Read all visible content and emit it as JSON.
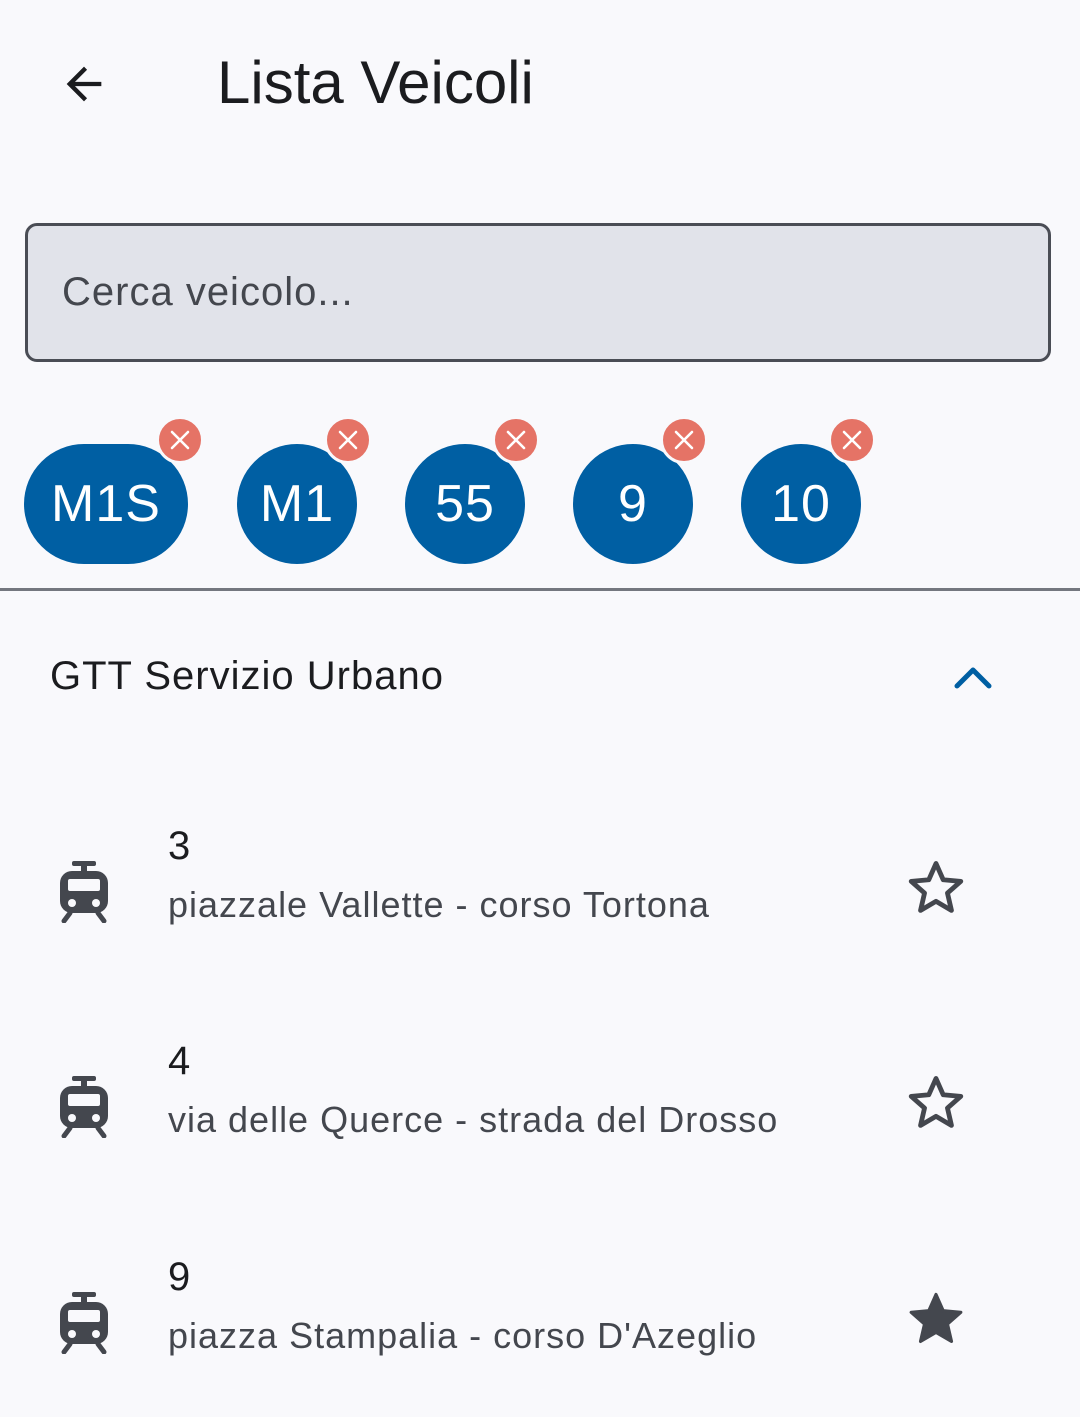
{
  "app_bar": {
    "back_icon": "arrow-back-icon",
    "title": "Lista Veicoli"
  },
  "search": {
    "placeholder": "Cerca veicolo...",
    "value": ""
  },
  "filter_chips": [
    {
      "label": "M1S",
      "remove_icon": "close-icon"
    },
    {
      "label": "M1",
      "remove_icon": "close-icon"
    },
    {
      "label": "55",
      "remove_icon": "close-icon"
    },
    {
      "label": "9",
      "remove_icon": "close-icon"
    },
    {
      "label": "10",
      "remove_icon": "close-icon"
    }
  ],
  "section": {
    "title": "GTT Servizio Urbano",
    "expanded": true,
    "toggle_icon": "chevron-up-icon"
  },
  "vehicles": [
    {
      "icon": "tram-icon",
      "line": "3",
      "route": "piazzale Vallette - corso Tortona",
      "favorite": false
    },
    {
      "icon": "tram-icon",
      "line": "4",
      "route": "via delle Querce - strada del Drosso",
      "favorite": false
    },
    {
      "icon": "tram-icon",
      "line": "9",
      "route": "piazza Stampalia - corso D'Azeglio",
      "favorite": true
    }
  ],
  "colors": {
    "background": "#f9f9fc",
    "chip": "#005fa3",
    "chip_remove": "#e57366",
    "accent": "#005fa3",
    "icon": "#44474e",
    "search_fill": "#e1e3ea"
  }
}
